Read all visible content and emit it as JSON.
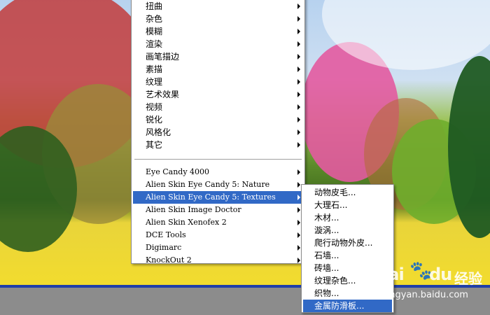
{
  "colors": {
    "menu_bg": "#ffffff",
    "selected_bg": "#3169c6",
    "selected_fg": "#ffffff",
    "taskbar_blue": "#1f3fa8",
    "status_gray": "#8c8c8c"
  },
  "filter_menu": {
    "top_items": [
      {
        "label": "扭曲"
      },
      {
        "label": "杂色"
      },
      {
        "label": "模糊"
      },
      {
        "label": "渲染"
      },
      {
        "label": "画笔描边"
      },
      {
        "label": "素描"
      },
      {
        "label": "纹理"
      },
      {
        "label": "艺术效果"
      },
      {
        "label": "视频"
      },
      {
        "label": "锐化"
      },
      {
        "label": "风格化"
      },
      {
        "label": "其它"
      }
    ],
    "plugin_items": [
      {
        "label": "Eye Candy 4000"
      },
      {
        "label": "Alien Skin Eye Candy 5: Nature"
      },
      {
        "label": "Alien Skin Eye Candy 5: Textures"
      },
      {
        "label": "Alien Skin Image Doctor"
      },
      {
        "label": "Alien Skin Xenofex 2"
      },
      {
        "label": "DCE Tools"
      },
      {
        "label": "Digimarc"
      },
      {
        "label": "KnockOut 2"
      }
    ]
  },
  "textures_submenu": {
    "items": [
      {
        "label": "动物皮毛..."
      },
      {
        "label": "大理石..."
      },
      {
        "label": "木材..."
      },
      {
        "label": "漩涡..."
      },
      {
        "label": "爬行动物外皮..."
      },
      {
        "label": "石墙..."
      },
      {
        "label": "砖墙..."
      },
      {
        "label": "纹理杂色..."
      },
      {
        "label": "织物..."
      },
      {
        "label": "金属防滑板..."
      }
    ]
  },
  "watermark": {
    "logo": "Bai",
    "logo_tail": "du",
    "text": "经验",
    "url": "jingyan.baidu.com"
  }
}
